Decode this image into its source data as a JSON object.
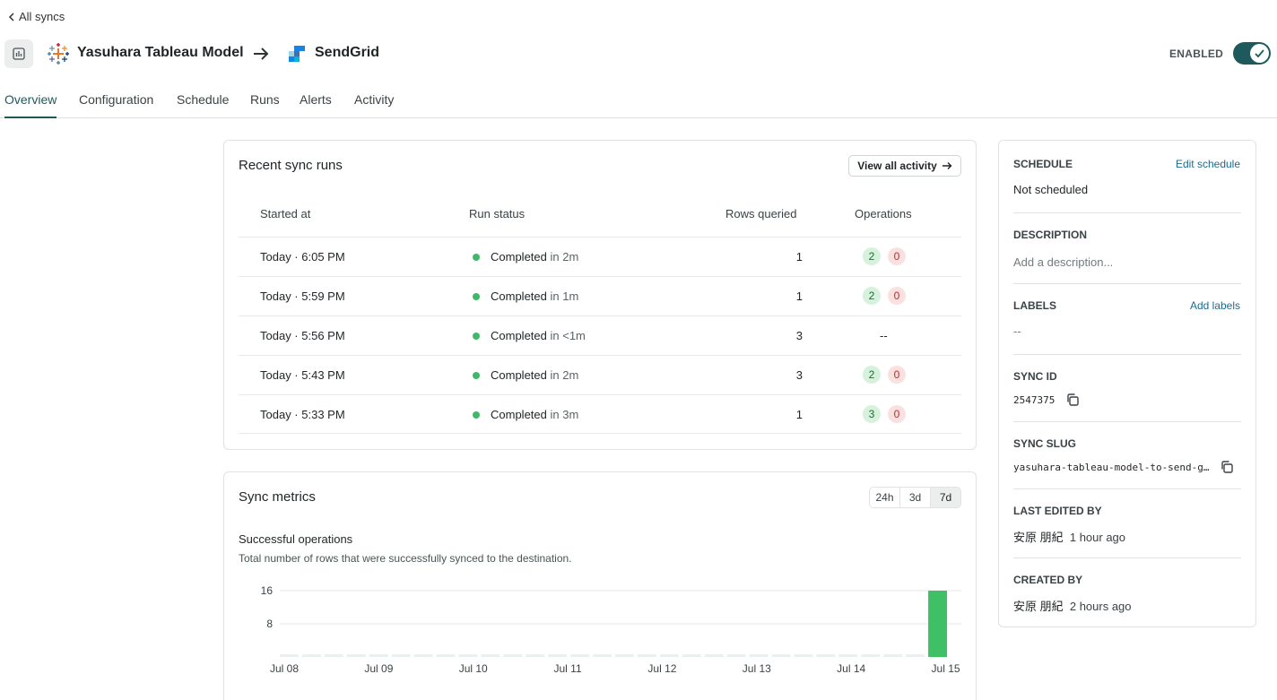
{
  "nav": {
    "back_label": "All syncs"
  },
  "header": {
    "source_name": "Yasuhara Tableau Model",
    "destination_name": "SendGrid",
    "status_label": "ENABLED",
    "enabled": true
  },
  "tabs": [
    {
      "label": "Overview",
      "active": true
    },
    {
      "label": "Configuration"
    },
    {
      "label": "Schedule"
    },
    {
      "label": "Runs"
    },
    {
      "label": "Alerts"
    },
    {
      "label": "Activity"
    }
  ],
  "recent_runs": {
    "title": "Recent sync runs",
    "view_all_label": "View all activity",
    "columns": [
      "Started at",
      "Run status",
      "Rows queried",
      "Operations"
    ],
    "rows": [
      {
        "started": "Today · 6:05 PM",
        "status": "Completed",
        "duration": "in 2m",
        "rows": "1",
        "ok": "2",
        "fail": "0"
      },
      {
        "started": "Today · 5:59 PM",
        "status": "Completed",
        "duration": "in 1m",
        "rows": "1",
        "ok": "2",
        "fail": "0"
      },
      {
        "started": "Today · 5:56 PM",
        "status": "Completed",
        "duration": "in <1m",
        "rows": "3",
        "ops_empty": "--"
      },
      {
        "started": "Today · 5:43 PM",
        "status": "Completed",
        "duration": "in 2m",
        "rows": "3",
        "ok": "2",
        "fail": "0"
      },
      {
        "started": "Today · 5:33 PM",
        "status": "Completed",
        "duration": "in 3m",
        "rows": "1",
        "ok": "3",
        "fail": "0"
      }
    ]
  },
  "metrics": {
    "title": "Sync metrics",
    "ranges": [
      "24h",
      "3d",
      "7d"
    ],
    "active_range": "7d",
    "chart_title": "Successful operations",
    "chart_subtitle": "Total number of rows that were successfully synced to the destination."
  },
  "chart_data": {
    "type": "bar",
    "title": "Successful operations",
    "subtitle": "Total number of rows that were successfully synced to the destination.",
    "xlabel": "",
    "ylabel": "",
    "ylim": [
      0,
      16
    ],
    "y_ticks": [
      "16",
      "8"
    ],
    "x_tick_labels": [
      "Jul 08",
      "Jul 09",
      "Jul 10",
      "Jul 11",
      "Jul 12",
      "Jul 13",
      "Jul 14",
      "Jul 15"
    ],
    "values": [
      0,
      0,
      0,
      0,
      0,
      0,
      0,
      0,
      0,
      0,
      0,
      0,
      0,
      0,
      0,
      0,
      0,
      0,
      0,
      0,
      0,
      0,
      0,
      0,
      0,
      0,
      0,
      0,
      0,
      16
    ],
    "grid": true,
    "bar_color": "#3fbf66",
    "empty_bar_color": "#eceff0"
  },
  "sidebar": {
    "schedule_label": "SCHEDULE",
    "edit_schedule_label": "Edit schedule",
    "schedule_value": "Not scheduled",
    "description_label": "DESCRIPTION",
    "description_placeholder": "Add a description...",
    "labels_label": "LABELS",
    "add_labels_label": "Add labels",
    "labels_value": "--",
    "sync_id_label": "SYNC ID",
    "sync_id_value": "2547375",
    "sync_slug_label": "SYNC SLUG",
    "sync_slug_value": "yasuhara-tableau-model-to-send-g…",
    "last_edited_label": "LAST EDITED BY",
    "last_edited_user": "安原 朋紀",
    "last_edited_time": "1 hour ago",
    "created_label": "CREATED BY",
    "created_user": "安原 朋紀",
    "created_time": "2 hours ago"
  },
  "colors": {
    "accent": "#1e5a5c",
    "link": "#1f6a8c",
    "success": "#3fb86b"
  }
}
